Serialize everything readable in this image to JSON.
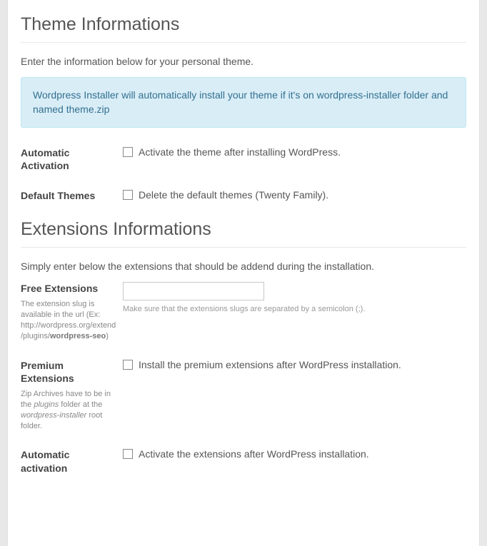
{
  "theme": {
    "heading": "Theme Informations",
    "intro": "Enter the information below for your personal theme.",
    "notice": "Wordpress Installer will automatically install your theme if it's on wordpress-installer folder and named theme.zip",
    "fields": {
      "auto_activation": {
        "label": "Automatic Activation",
        "checkbox_text": "Activate the theme after installing WordPress."
      },
      "default_themes": {
        "label": "Default Themes",
        "checkbox_text": "Delete the default themes (Twenty Family)."
      }
    }
  },
  "extensions": {
    "heading": "Extensions Informations",
    "intro": "Simply enter below the extensions that should be addend during the installation.",
    "fields": {
      "free": {
        "label": "Free Extensions",
        "help_pre": "The extension slug is available in the url (Ex: http://wordpress.org/extend/plugins/",
        "help_bold": "wordpress-seo",
        "help_post": ")",
        "input_value": "",
        "note": "Make sure that the extensions slugs are separated by a semicolon (;)."
      },
      "premium": {
        "label": "Premium Extensions",
        "help_1": "Zip Archives have to be in the ",
        "help_i1": "plugins",
        "help_2": " folder at the ",
        "help_i2": "wordpress-installer",
        "help_3": " root folder.",
        "checkbox_text": "Install the premium extensions after WordPress installation."
      },
      "auto_activation": {
        "label": "Automatic activation",
        "checkbox_text": "Activate the extensions after WordPress installation."
      }
    }
  }
}
